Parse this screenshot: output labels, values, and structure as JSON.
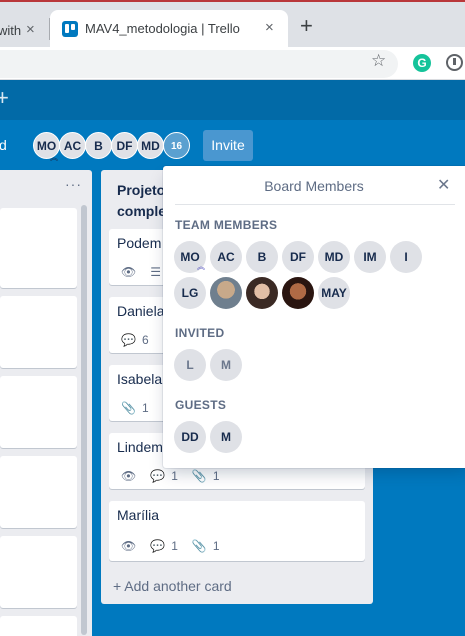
{
  "browser": {
    "prev_tab_title": "with",
    "active_tab_title": "MAV4_metodologia | Trello",
    "close_icon": "×",
    "new_tab_icon": "+",
    "star_icon": "☆",
    "grammarly_letter": "G"
  },
  "board": {
    "name_fragment": "d",
    "members": [
      "MO",
      "AC",
      "B",
      "DF",
      "MD"
    ],
    "member_count": "16",
    "invite_label": "Invite"
  },
  "left_list": {
    "menu_icon": "···"
  },
  "right_list": {
    "title": "Projeto complet",
    "cards": [
      {
        "title": "Podem",
        "badges": []
      },
      {
        "title": "Daniela",
        "badges": [
          "6"
        ]
      },
      {
        "title": "Isabela",
        "badges": [
          "1"
        ]
      },
      {
        "title": "Lindem",
        "badges": [
          "1",
          "1"
        ]
      },
      {
        "title": "Marília",
        "badges": [
          "1",
          "1"
        ]
      }
    ],
    "add_card_label": "+ Add another card"
  },
  "popover": {
    "title": "Board Members",
    "team_label": "TEAM MEMBERS",
    "team_row1": [
      "MO",
      "AC",
      "B",
      "DF",
      "MD",
      "IM",
      "I"
    ],
    "team_row2_initials_first": "LG",
    "team_row2_last": "MAY",
    "invited_label": "INVITED",
    "invited": [
      "L",
      "M"
    ],
    "guests_label": "GUESTS",
    "guests": [
      "DD",
      "M"
    ]
  },
  "colors": {
    "board_bg": "#0079bf",
    "header_bg": "#026aa7",
    "list_bg": "#ebecf0",
    "avatar_bg": "#dfe1e6"
  }
}
